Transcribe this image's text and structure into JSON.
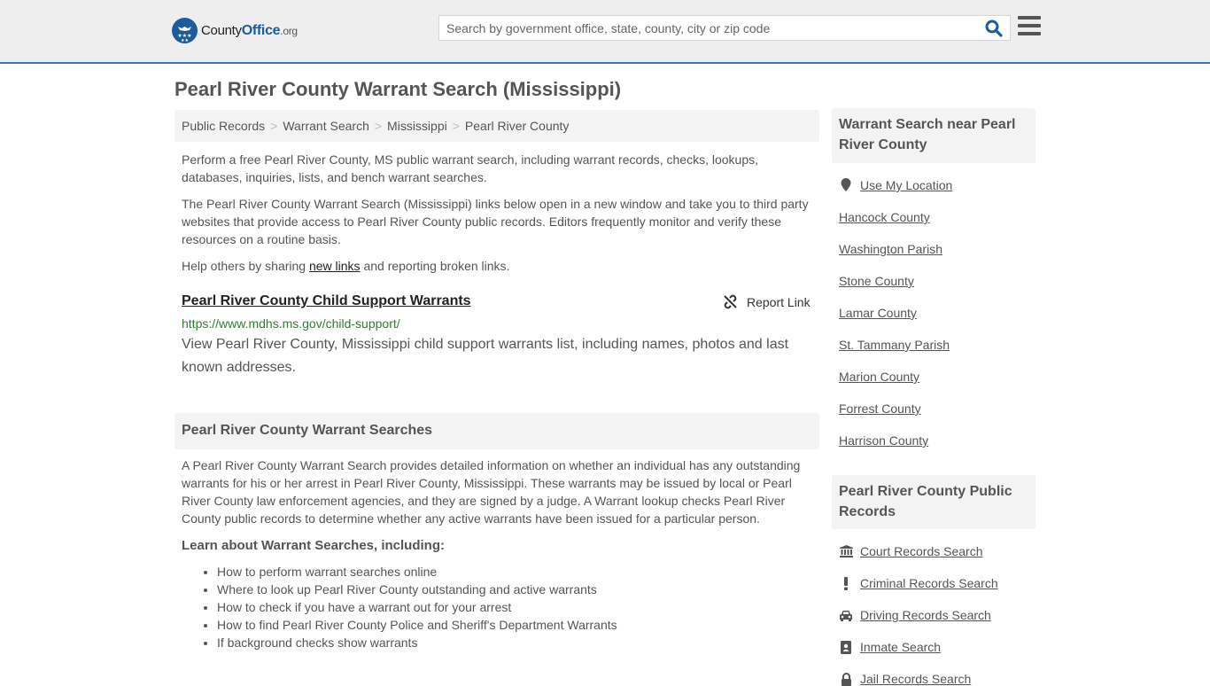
{
  "header": {
    "logo": {
      "county": "County",
      "office": "Office",
      "org": ".org"
    },
    "search": {
      "placeholder": "Search by government office, state, county, city or zip code",
      "value": ""
    },
    "colors": {
      "brand": "#1e5b99",
      "header_border": "#3b78a8"
    }
  },
  "page": {
    "title": "Pearl River County Warrant Search (Mississippi)",
    "breadcrumb": [
      {
        "label": "Public Records"
      },
      {
        "label": "Warrant Search"
      },
      {
        "label": "Mississippi"
      },
      {
        "label": "Pearl River County"
      }
    ],
    "intro": {
      "p1": "Perform a free Pearl River County, MS public warrant search, including warrant records, checks, lookups, databases, inquiries, lists, and bench warrant searches.",
      "p2": "The Pearl River County Warrant Search (Mississippi) links below open in a new window and take you to third party websites that provide access to Pearl River County public records. Editors frequently monitor and verify these resources on a routine basis.",
      "p3_before": "Help others by sharing ",
      "p3_link": "new links",
      "p3_after": " and reporting broken links."
    },
    "listing": {
      "title": "Pearl River County Child Support Warrants",
      "report_label": "Report Link",
      "url": "https://www.mdhs.ms.gov/child-support/",
      "description": "View Pearl River County, Mississippi child support warrants list, including names, photos and last known addresses."
    },
    "section": {
      "heading": "Pearl River County Warrant Searches",
      "body": "A Pearl River County Warrant Search provides detailed information on whether an individual has any outstanding warrants for his or her arrest in Pearl River County, Mississippi. These warrants may be issued by local or Pearl River County law enforcement agencies, and they are signed by a judge. A Warrant lookup checks Pearl River County public records to determine whether any active warrants have been issued for a particular person.",
      "learn_heading": "Learn about Warrant Searches, including:",
      "learn_items": [
        "How to perform warrant searches online",
        "Where to look up Pearl River County outstanding and active warrants",
        "How to check if you have a warrant out for your arrest",
        "How to find Pearl River County Police and Sheriff's Department Warrants",
        "If background checks show warrants"
      ]
    }
  },
  "sidebar": {
    "nearby": {
      "heading": "Warrant Search near Pearl River County",
      "use_location": "Use My Location",
      "items": [
        "Hancock County",
        "Washington Parish",
        "Stone County",
        "Lamar County",
        "St. Tammany Parish",
        "Marion County",
        "Forrest County",
        "Harrison County"
      ]
    },
    "public_records": {
      "heading": "Pearl River County Public Records",
      "items": [
        {
          "label": "Court Records Search",
          "icon": "courthouse-icon"
        },
        {
          "label": "Criminal Records Search",
          "icon": "exclamation-icon"
        },
        {
          "label": "Driving Records Search",
          "icon": "car-icon"
        },
        {
          "label": "Inmate Search",
          "icon": "id-badge-icon"
        },
        {
          "label": "Jail Records Search",
          "icon": "lock-icon"
        }
      ]
    }
  }
}
